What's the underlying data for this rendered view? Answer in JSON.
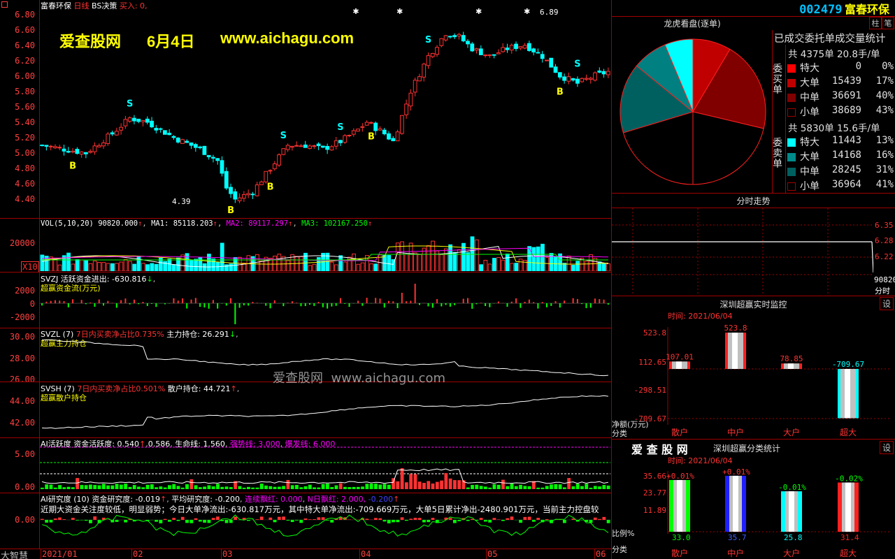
{
  "header": {
    "stock_name": "富春环保",
    "period": "日线",
    "indicator_name": "BS决策",
    "buy_signal": "买入: 0,",
    "price_high_marker": "6.89",
    "price_low_marker": "4.39"
  },
  "watermark": {
    "site_name": "爱查股网",
    "date": "6月4日",
    "url": "www.aichagu.com",
    "center_overlay": "爱查股网  www.aichagu.com"
  },
  "main_axis": [
    "6.80",
    "6.60",
    "6.40",
    "6.20",
    "6.00",
    "5.80",
    "5.60",
    "5.40",
    "5.20",
    "5.00",
    "4.80",
    "4.60",
    "4.40"
  ],
  "vol_panel": {
    "title_prefix": "VOL(5,10,20)",
    "vol": "90820.000",
    "ma1_label": "MA1:",
    "ma1": "85118.203",
    "ma2_label": "MA2:",
    "ma2": "89117.297",
    "ma3_label": "MA3:",
    "ma3": "102167.250",
    "axis": [
      "20000"
    ],
    "unit": "X10"
  },
  "svzj_panel": {
    "name": "SVZJ",
    "label": "活跃资金进出:",
    "value": "-630.816",
    "subtitle": "超赢资金流(万元)",
    "axis": [
      "2000",
      "0",
      "-2000"
    ]
  },
  "svzl_panel": {
    "name": "SVZL (7)",
    "label1": "7日内买卖净占比0.735%",
    "label2": "主力持仓:",
    "value": "26.291",
    "subtitle": "超赢主力持仓",
    "axis": [
      "30.00",
      "28.00",
      "26.00"
    ]
  },
  "svsh_panel": {
    "name": "SVSH (7)",
    "label1": "7日内买卖净占比0.501%",
    "label2": "散户持仓:",
    "value": "44.721",
    "subtitle": "超赢散户持仓",
    "axis": [
      "44.00",
      "42.00"
    ]
  },
  "ai_active_panel": {
    "name": "AI活跃度",
    "label": "资金活跃度:",
    "value1": "0.540",
    "value2": "0.586",
    "life_label": "生命线:",
    "life_value": "1.560",
    "strong_label": "强势线:",
    "strong_value": "3.000",
    "burst_label": "爆发线:",
    "burst_value": "6.000",
    "axis": [
      "5.00",
      "0.00"
    ]
  },
  "ai_research_panel": {
    "name": "AI研究度 (10)",
    "label1": "资金研究度:",
    "value1": "-0.019",
    "label2": "平均研究度:",
    "value2": "-0.200",
    "label3": "连续飘红:",
    "value3": "0.000",
    "label4": "N日飘红:",
    "value4": "2.000,",
    "value5": "-0.200",
    "commentary": "近期大资金关注度较低，明显弱势；今日大单净流出:-630.817万元，其中特大单净流出:-709.669万元，大单5日累计净出-2480.901万元，当前主力控盘较",
    "axis": [
      "0.00"
    ]
  },
  "bottom_bar": {
    "brand": "大智慧",
    "dates": [
      "2021/01",
      "02",
      "03",
      "04",
      "05",
      "06"
    ]
  },
  "right_panel": {
    "stock_code": "002479",
    "stock_name": "富春环保",
    "button_pillar": "柱",
    "button_note": "笔",
    "dragon_title": "龙虎看盘(逐单)",
    "stats_title": "已成交委托单成交量统计",
    "buy_total": "共 4375单 20.8手/单",
    "buy_label": "委买单",
    "buy_rows": [
      {
        "label": "特大",
        "value": "0",
        "pct": "0%",
        "color": "#ff0000"
      },
      {
        "label": "大单",
        "value": "15439",
        "pct": "17%",
        "color": "#c00000"
      },
      {
        "label": "中单",
        "value": "36691",
        "pct": "40%",
        "color": "#800000"
      },
      {
        "label": "小单",
        "value": "38689",
        "pct": "43%",
        "color": "#000000"
      }
    ],
    "sell_total": "共 5830单 15.6手/单",
    "sell_label": "委卖单",
    "sell_rows": [
      {
        "label": "特大",
        "value": "11443",
        "pct": "13%",
        "color": "#00ffff"
      },
      {
        "label": "大单",
        "value": "14168",
        "pct": "16%",
        "color": "#008b8b"
      },
      {
        "label": "中单",
        "value": "28245",
        "pct": "31%",
        "color": "#006060"
      },
      {
        "label": "小单",
        "value": "36964",
        "pct": "41%",
        "color": "#000000"
      }
    ],
    "intraday_title": "分时走势",
    "intraday_axis": [
      "6.35",
      "6.28",
      "6.22"
    ],
    "intraday_vol": "90820",
    "intraday_unit": "分时",
    "monitor_title": "深圳超赢实时监控",
    "monitor_button": "设",
    "monitor_time": "时间: 2021/06/04",
    "monitor_axis": [
      "523.8",
      "112.65",
      "-298.51",
      "-709.67"
    ],
    "monitor_unit1": "净额(万元)",
    "monitor_unit2": "分类",
    "monitor_bars": [
      {
        "label": "散户",
        "value": "107.01",
        "amount": 107.01
      },
      {
        "label": "中户",
        "value": "523.8",
        "amount": 523.8
      },
      {
        "label": "大户",
        "value": "78.85",
        "amount": 78.85
      },
      {
        "label": "超大",
        "value": "-709.67",
        "amount": -709.67
      }
    ],
    "category_brand": "爱 查 股 网",
    "category_title": "深圳超赢分类统计",
    "category_button": "设",
    "category_time": "时间: 2021/06/04",
    "category_axis": [
      "35.66",
      "23.77",
      "11.89"
    ],
    "category_unit1": "比例%",
    "category_unit2": "分类",
    "category_bars": [
      {
        "label": "散户",
        "value": "33.0",
        "change": "+0.01%",
        "pct": 33.0,
        "color": "#00ff00"
      },
      {
        "label": "中户",
        "value": "35.7",
        "change": "+0.01%",
        "pct": 35.7,
        "color": "#2020ff"
      },
      {
        "label": "大户",
        "value": "25.8",
        "change": "-0.01%",
        "pct": 25.8,
        "color": "#00ffff"
      },
      {
        "label": "超大",
        "value": "31.4",
        "change": "-0.02%",
        "pct": 31.4,
        "color": "#ff2020"
      }
    ]
  }
}
